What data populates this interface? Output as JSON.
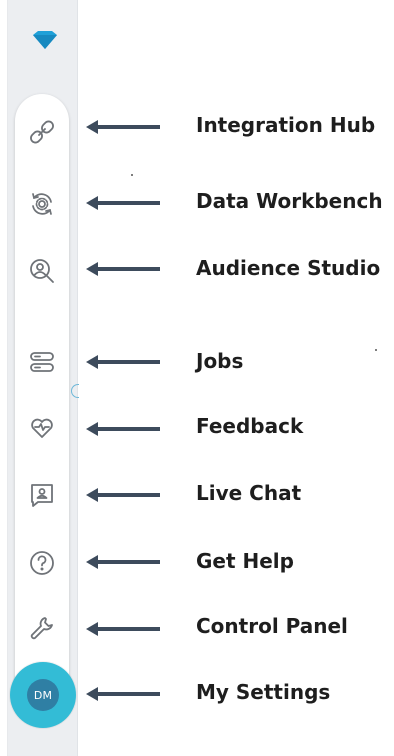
{
  "logo": {
    "icon": "diamond-logo-icon",
    "color": "#1fa0d8"
  },
  "nav_items": [
    {
      "id": "integration-hub",
      "label": "Integration Hub",
      "icon": "link-icon"
    },
    {
      "id": "data-workbench",
      "label": "Data Workbench",
      "icon": "gear-cycle-icon"
    },
    {
      "id": "audience-studio",
      "label": "Audience Studio",
      "icon": "user-search-icon"
    },
    {
      "id": "jobs",
      "label": "Jobs",
      "icon": "jobs-list-icon"
    },
    {
      "id": "feedback",
      "label": "Feedback",
      "icon": "heart-feedback-icon"
    },
    {
      "id": "live-chat",
      "label": "Live Chat",
      "icon": "chat-user-icon"
    },
    {
      "id": "get-help",
      "label": "Get Help",
      "icon": "question-circle-icon"
    },
    {
      "id": "control-panel",
      "label": "Control Panel",
      "icon": "wrench-icon"
    }
  ],
  "my_settings": {
    "label": "My Settings",
    "avatar_initials": "DM",
    "avatar_color": "#33bcd6"
  },
  "colors": {
    "icon_stroke": "#6f7378",
    "arrow": "#3d4b5c",
    "label": "#1e1e1e",
    "rail": "#eceef1"
  }
}
